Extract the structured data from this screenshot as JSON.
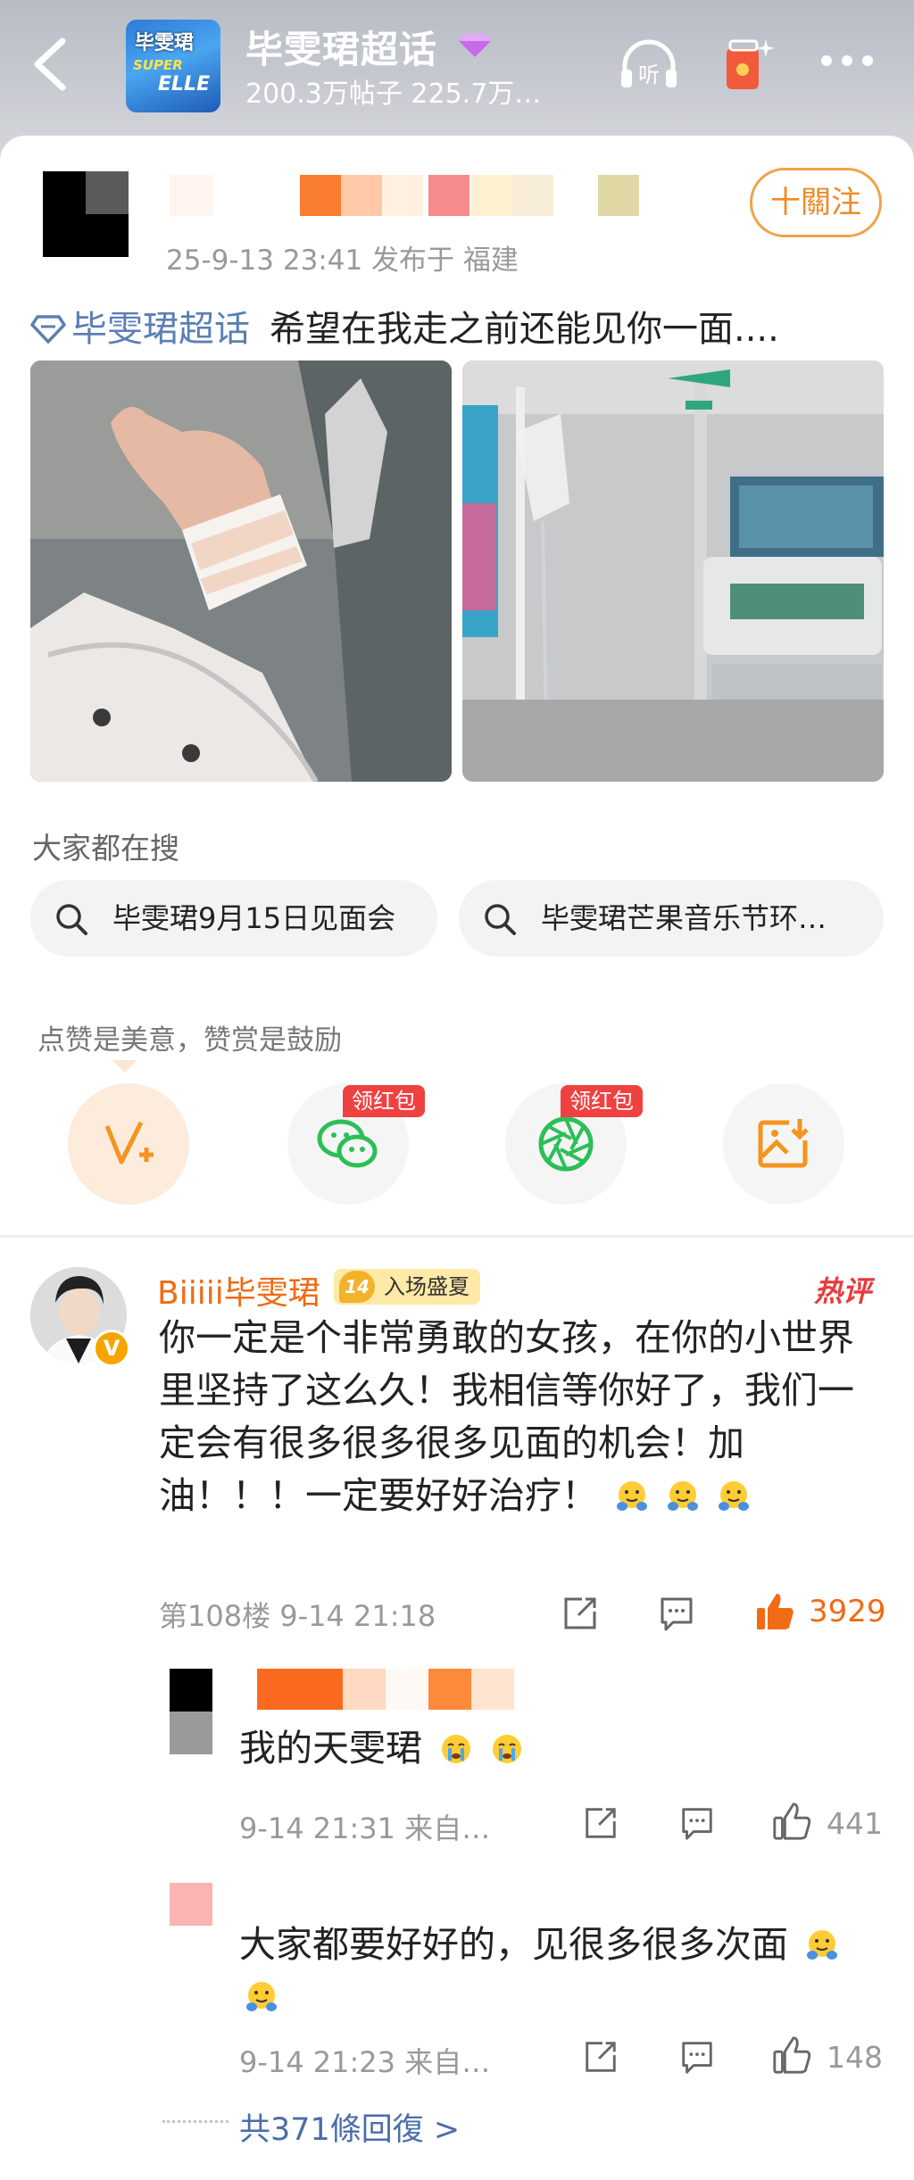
{
  "header": {
    "title": "毕雯珺超话",
    "stats": "200.3万帖子 225.7万…",
    "avatar_text": [
      "毕雯珺",
      "SUPER",
      "ELLE"
    ],
    "listen_label": "听"
  },
  "post": {
    "follow_label": "十關注",
    "meta": "25-9-13 23:41  发布于 福建",
    "topic_tag": "毕雯珺超话",
    "text": "希望在我走之前还能见你一面...."
  },
  "search": {
    "heading": "大家都在搜",
    "chips": [
      "毕雯珺9月15日见面会",
      "毕雯珺芒果音乐节环…"
    ]
  },
  "actions": {
    "praise_text": "点赞是美意，赞赏是鼓励",
    "tags": [
      "领红包",
      "领红包"
    ]
  },
  "comment": {
    "name": "Biiiii毕雯珺",
    "level_num": "14",
    "level_label": "入场盛夏",
    "hot_tag": "热评",
    "body": "你一定是个非常勇敢的女孩，在你的小世界里坚持了这么久！我相信等你好了，我们一定会有很多很多很多见面的机会！加油！！！一定要好好治疗！",
    "meta": "第108楼  9-14 21:18",
    "likes": "3929"
  },
  "replies": [
    {
      "body": "我的天雯珺",
      "meta": "9-14 21:31 来自…",
      "likes": "441"
    },
    {
      "body": "大家都要好好的，见很多很多次面",
      "meta": "9-14 21:23 来自…",
      "likes": "148"
    }
  ],
  "more_replies": "共371條回復 >",
  "colors": {
    "accent_orange": "#f06b14",
    "follow_border": "#f0a24a",
    "topic_blue": "#5b7fb3",
    "red_tag": "#f04141"
  }
}
